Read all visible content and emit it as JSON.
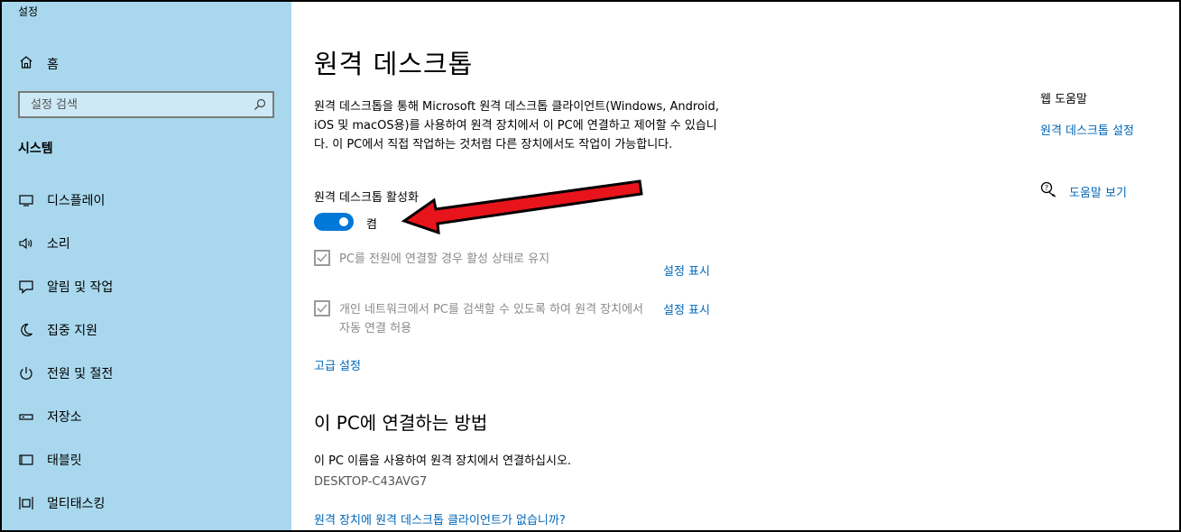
{
  "window": {
    "title": "설정"
  },
  "sidebar": {
    "home_label": "홈",
    "search_placeholder": "설정 검색",
    "section_title": "시스템",
    "items": [
      {
        "label": "디스플레이",
        "icon": "display-icon"
      },
      {
        "label": "소리",
        "icon": "speaker-icon"
      },
      {
        "label": "알림 및 작업",
        "icon": "notification-icon"
      },
      {
        "label": "집중 지원",
        "icon": "moon-icon"
      },
      {
        "label": "전원 및 절전",
        "icon": "power-icon"
      },
      {
        "label": "저장소",
        "icon": "storage-icon"
      },
      {
        "label": "태블릿",
        "icon": "tablet-icon"
      },
      {
        "label": "멀티태스킹",
        "icon": "multitasking-icon"
      }
    ]
  },
  "main": {
    "title": "원격 데스크톱",
    "description": "원격 데스크톱을 통해 Microsoft 원격 데스크톱 클라이언트(Windows, Android, iOS 및 macOS용)를 사용하여 원격 장치에서 이 PC에 연결하고 제어할 수 있습니다. 이 PC에서 직접 작업하는 것처럼 다른 장치에서도 작업이 가능합니다.",
    "enable_label": "원격 데스크톱 활성화",
    "toggle_state": "켬",
    "toggle_on": true,
    "checkbox1": {
      "label": "PC를 전원에 연결할 경우 활성 상태로 유지",
      "checked": true,
      "link": "설정 표시"
    },
    "checkbox2": {
      "label": "개인 네트워크에서 PC를 검색할 수 있도록 하여 원격 장치에서 자동 연결 허용",
      "checked": true,
      "link": "설정 표시"
    },
    "advanced_link": "고급 설정",
    "connect_heading": "이 PC에 연결하는 방법",
    "connect_desc": "이 PC 이름을 사용하여 원격 장치에서 연결하십시오.",
    "pc_name": "DESKTOP-C43AVG7",
    "no_client_link": "원격 장치에 원격 데스크톱 클라이언트가 없습니까?"
  },
  "help": {
    "title": "웹 도움말",
    "link": "원격 데스크톱 설정",
    "get_help": "도움말 보기"
  },
  "colors": {
    "sidebar_bg": "#a9d8ee",
    "accent": "#0078d7",
    "link": "#0067b8",
    "arrow": "#e8141b"
  }
}
